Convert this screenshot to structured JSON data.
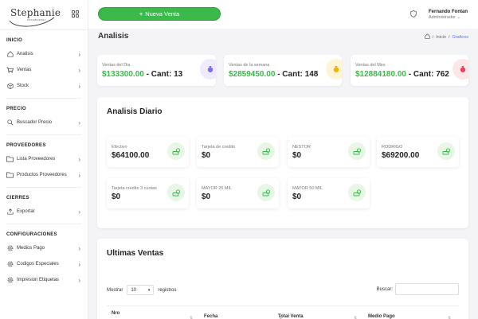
{
  "brand": {
    "name": "Stephanie",
    "tagline": "DISTRIBUIDORA"
  },
  "sidebar": {
    "sections": [
      {
        "title": "INICIO",
        "items": [
          {
            "label": "Analisis",
            "icon": "home-icon"
          },
          {
            "label": "Ventas",
            "icon": "cart-icon"
          },
          {
            "label": "Stock",
            "icon": "box-icon"
          }
        ]
      },
      {
        "title": "PRECIO",
        "items": [
          {
            "label": "Buscador Precio",
            "icon": "search-icon"
          }
        ]
      },
      {
        "title": "PROVEEDORES",
        "items": [
          {
            "label": "Lista Proveedores",
            "icon": "folder-icon"
          },
          {
            "label": "Productos Proveedores",
            "icon": "folder-icon"
          }
        ]
      },
      {
        "title": "CIERRES",
        "items": [
          {
            "label": "Exportar",
            "icon": "export-icon"
          }
        ]
      },
      {
        "title": "CONFIGURACIONES",
        "items": [
          {
            "label": "Medios Pago",
            "icon": "gear-icon"
          },
          {
            "label": "Codigos Especiales",
            "icon": "gear-icon"
          },
          {
            "label": "Impresion Etiquetas",
            "icon": "gear-icon"
          }
        ]
      }
    ]
  },
  "topbar": {
    "new_sale_label": "Nueva Venta",
    "user_name": "Fernando Fontan",
    "user_role": "Administrador"
  },
  "page": {
    "title": "Analisis",
    "breadcrumb": {
      "home": "Inicio",
      "sep": "/",
      "current": "Graficos"
    }
  },
  "summary": [
    {
      "label": "Ventas del Dia",
      "amount": "$133300.00",
      "count": "- Cant: 13",
      "color": "#7b6ff0",
      "bg": "#efeafe"
    },
    {
      "label": "Ventas de la semana",
      "amount": "$2859450.00",
      "count": "- Cant: 148",
      "color": "#f2b300",
      "bg": "#fff5d6"
    },
    {
      "label": "Ventas del Mes",
      "amount": "$12884180.00",
      "count": "- Cant: 762",
      "color": "#e8455a",
      "bg": "#fde6ea"
    }
  ],
  "daily": {
    "title": "Analisis Diario",
    "cards": [
      {
        "label": "Efectivo",
        "value": "$64100.00"
      },
      {
        "label": "Tarjeta de credito",
        "value": "$0"
      },
      {
        "label": "NESTOR",
        "value": "$0"
      },
      {
        "label": "RODRIGO",
        "value": "$69200.00"
      },
      {
        "label": "Tarjeta credito 3 cuotas",
        "value": "$0"
      },
      {
        "label": "MAYOR 25 MIL",
        "value": "$0"
      },
      {
        "label": "MAYOR 50 MIL",
        "value": "$0"
      }
    ],
    "icon_color": "#3cb94a"
  },
  "sales": {
    "title": "Ultimas Ventas",
    "show_label": "Mostrar",
    "page_size": "10",
    "records_label": "registros",
    "search_label": "Buscar:",
    "columns": [
      "Nro",
      "Fecha",
      "Total Venta",
      "Medio Pago"
    ]
  },
  "colors": {
    "accent": "#3cb94a",
    "link": "#6571e8"
  }
}
